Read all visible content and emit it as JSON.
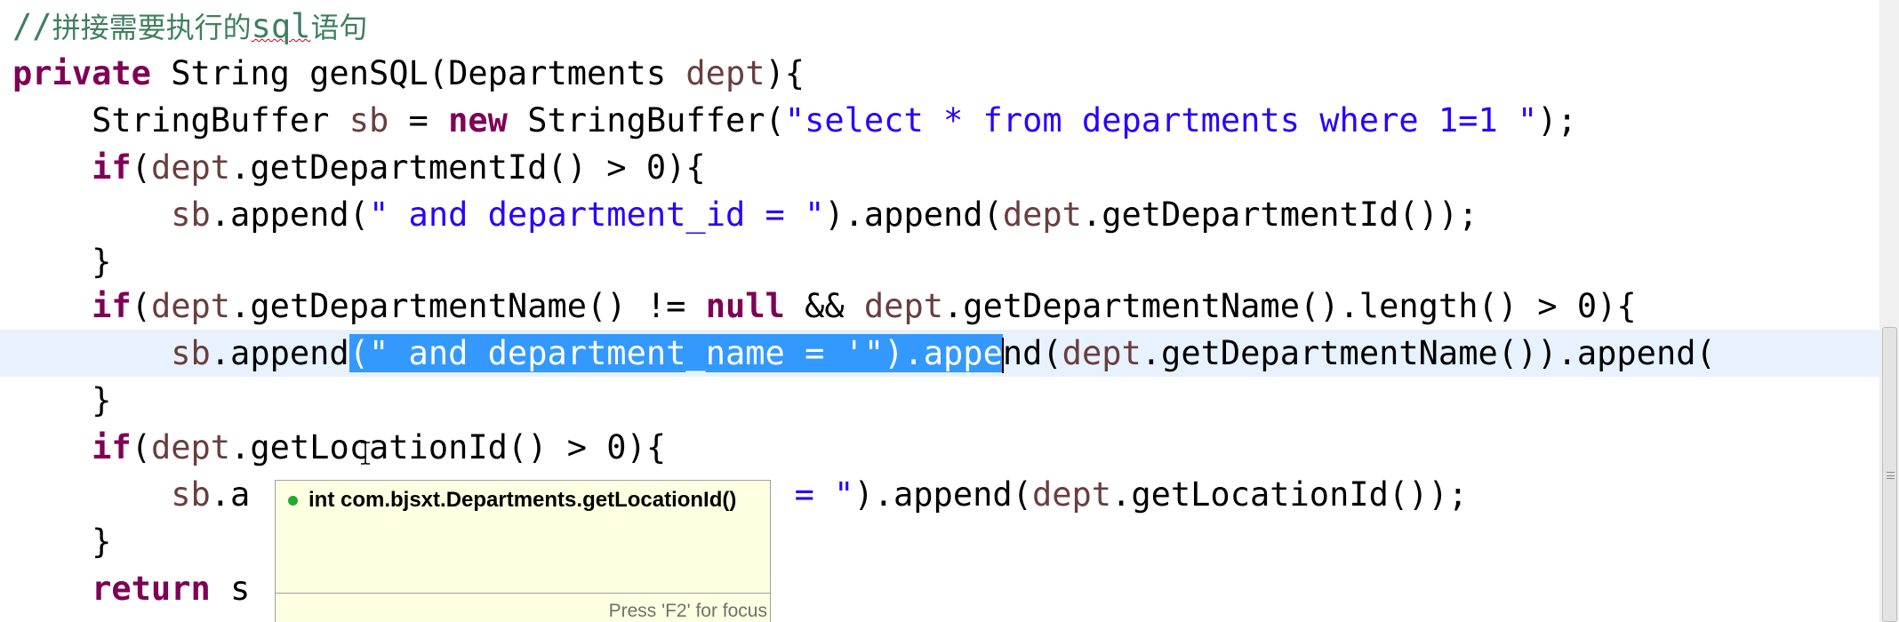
{
  "editor": {
    "language": "java",
    "comment": {
      "prefix": "//",
      "text_cn": "拼接需要执行的",
      "text_sql": "sql",
      "text_end": "语句"
    },
    "lines": {
      "l2": {
        "kw_private": "private",
        "rest": " String genSQL(Departments ",
        "var": "dept",
        "end": "){"
      },
      "l3": {
        "indent": "    ",
        "type": "StringBuffer ",
        "var": "sb",
        "eq": " = ",
        "kw_new": "new",
        "ctor": " StringBuffer(",
        "str": "\"select * from departments where 1=1 \"",
        "end": ");"
      },
      "l4": {
        "indent": "    ",
        "kw_if": "if",
        "open": "(",
        "var": "dept",
        "rest": ".getDepartmentId() > 0){"
      },
      "l5": {
        "indent": "        ",
        "var": "sb",
        "call": ".append(",
        "str": "\" and department_id = \"",
        "mid": ").append(",
        "var2": "dept",
        "end": ".getDepartmentId());"
      },
      "l6": {
        "indent": "    ",
        "text": "}"
      },
      "l7": {
        "indent": "    ",
        "kw_if": "if",
        "open": "(",
        "var": "dept",
        "mid": ".getDepartmentName() != ",
        "kw_null": "null",
        "and": " && ",
        "var2": "dept",
        "end": ".getDepartmentName().length() > 0){"
      },
      "l8": {
        "indent": "        ",
        "var": "sb",
        "pre": ".append",
        "sel_open": "(",
        "sel_str": "\" and department_name = '\"",
        "sel_after": ").appe",
        "post": "nd(",
        "var2": "dept",
        "end": ".getDepartmentName()).append("
      },
      "l9": {
        "indent": "    ",
        "text": "}"
      },
      "l10": {
        "indent": "    ",
        "kw_if": "if",
        "open": "(",
        "var": "dept",
        "rest": ".getLocationId() > 0){"
      },
      "l11": {
        "indent": "        ",
        "var": "sb",
        "pre": ".a",
        "str_tail": " = \"",
        "mid": ").append(",
        "var2": "dept",
        "end": ".getLocationId());"
      },
      "l12": {
        "indent": "    ",
        "text": "}"
      },
      "l13": {
        "indent": "    ",
        "kw_return": "return",
        "rest": " s"
      }
    },
    "colors": {
      "keyword": "#7f0055",
      "string": "#2a00ff",
      "variable": "#6a3e3e",
      "comment": "#3f7f5f",
      "selection": "#3399ff",
      "current_line": "#e8f2fe",
      "tooltip_bg": "#ffffe1"
    }
  },
  "hover": {
    "icon": "public-method-icon",
    "signature": "int com.bjsxt.Departments.getLocationId()",
    "footer": "Press 'F2' for focus"
  }
}
